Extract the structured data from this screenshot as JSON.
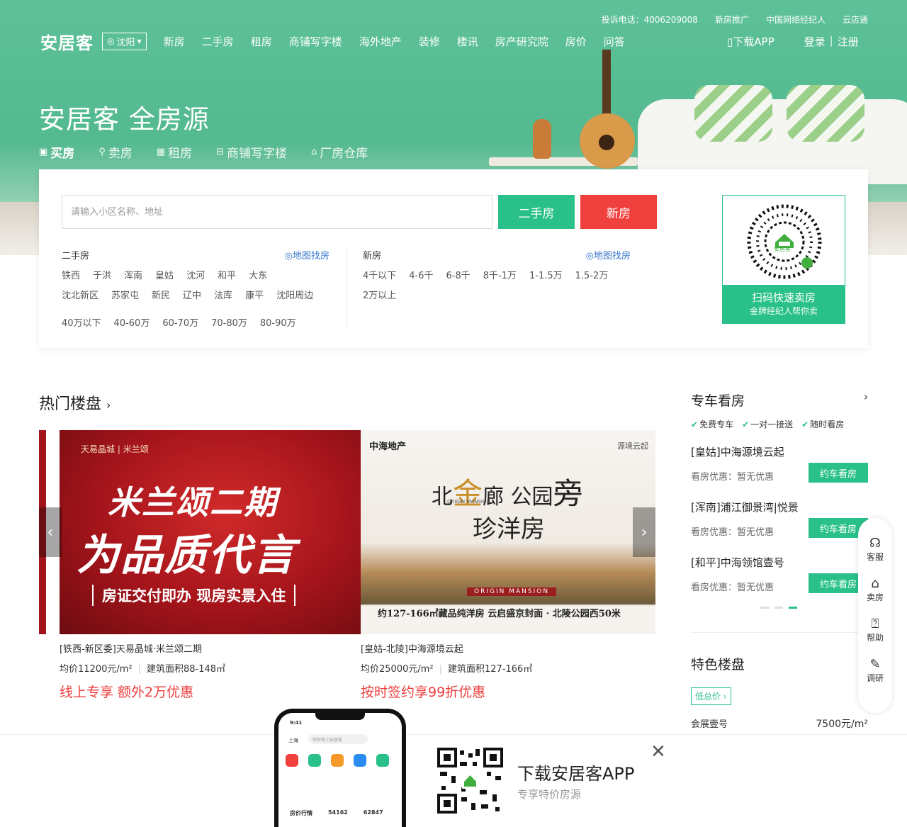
{
  "top_links": [
    "投诉电话：4006209008",
    "新房推广",
    "中国网络经纪人",
    "云店通"
  ],
  "nav": {
    "logo": "安居客",
    "city": "沈阳",
    "links": [
      "新房",
      "二手房",
      "租房",
      "商铺写字楼",
      "海外地产",
      "装修",
      "楼讯",
      "房产研究院",
      "房价",
      "问答"
    ],
    "download_app": "下载APP",
    "login": "登录",
    "register": "注册"
  },
  "hero": {
    "slogan": "安居客 全房源",
    "tabs": [
      "买房",
      "卖房",
      "租房",
      "商铺写字楼",
      "厂房仓库"
    ]
  },
  "search": {
    "placeholder": "请输入小区名称、地址",
    "btn_secondhand": "二手房",
    "btn_new": "新房",
    "secondhand": {
      "title": "二手房",
      "map_link": "地图找房",
      "districts": [
        "铁西",
        "于洪",
        "浑南",
        "皇姑",
        "沈河",
        "和平",
        "大东",
        "沈北新区",
        "苏家屯",
        "新民",
        "辽中",
        "法库",
        "康平",
        "沈阳周边"
      ],
      "prices": [
        "40万以下",
        "40-60万",
        "60-70万",
        "70-80万",
        "80-90万"
      ]
    },
    "newhouse": {
      "title": "新房",
      "map_link": "地图找房",
      "prices": [
        "4千以下",
        "4-6千",
        "6-8千",
        "8千-1万",
        "1-1.5万",
        "1.5-2万",
        "2万以上"
      ]
    },
    "qr": {
      "label": "安居客",
      "line1": "扫码快速卖房",
      "line2": "金牌经纪人帮你卖"
    }
  },
  "hot": {
    "title": "热门楼盘",
    "slides": [
      {
        "brand": "天易晶城 | 米兰颂",
        "headline1": "米兰颂二期",
        "headline2": "为品质代言",
        "sub": "房证交付即办 现房实景入住"
      },
      {
        "brand": "中海地产",
        "brand2": "源境云起",
        "headline1_a": "北",
        "headline1_b": "金",
        "headline1_c": "廊 公园",
        "headline1_d": "旁",
        "headline2": "珍洋房",
        "origin": "ORIGIN MANSION",
        "band": "ORIGIN MANSION",
        "footer": "约127-166㎡藏品纯洋房 云启盛京封面 · 北陵公园西50米"
      }
    ],
    "cards": [
      {
        "name": "[铁西-新区委]天易晶城·米兰颂二期",
        "price": "均价11200元/m²",
        "area": "建筑面积88-148㎡",
        "promo": "线上专享 额外2万优惠"
      },
      {
        "name": "[皇姑-北陵]中海源境云起",
        "price": "均价25000元/m²",
        "area": "建筑面积127-166㎡",
        "promo": "按时签约享99折优惠"
      }
    ]
  },
  "car_tour": {
    "title": "专车看房",
    "features": [
      "免费专车",
      "一对一接送",
      "随时看房"
    ],
    "items": [
      {
        "name": "[皇姑]中海源境云起",
        "discount": "看房优惠：暂无优惠",
        "btn": "约车看房"
      },
      {
        "name": "[浑南]浦江御景湾|悦景",
        "discount": "看房优惠：暂无优惠",
        "btn": "约车看房"
      },
      {
        "name": "[和平]中海领馆壹号",
        "discount": "看房优惠：暂无优惠",
        "btn": "约车看房"
      }
    ]
  },
  "featured": {
    "title": "特色楼盘",
    "tag": "低总价",
    "item_name": "会展壹号",
    "item_price": "7500元/m²"
  },
  "sidebar": [
    "客服",
    "卖房",
    "帮助",
    "调研"
  ],
  "app_banner": {
    "title": "下载安居客APP",
    "subtitle": "专享特价房源",
    "phone_time": "9:41",
    "phone_city": "上海",
    "phone_search": "你好美上安居客",
    "phone_price_label": "房价行情",
    "phone_price1": "54162",
    "phone_price2": "62847"
  },
  "colors": {
    "brand_green": "#29c189",
    "red": "#f0403e",
    "link_blue": "#3777ce",
    "promo_red": "#ee3d3d"
  }
}
